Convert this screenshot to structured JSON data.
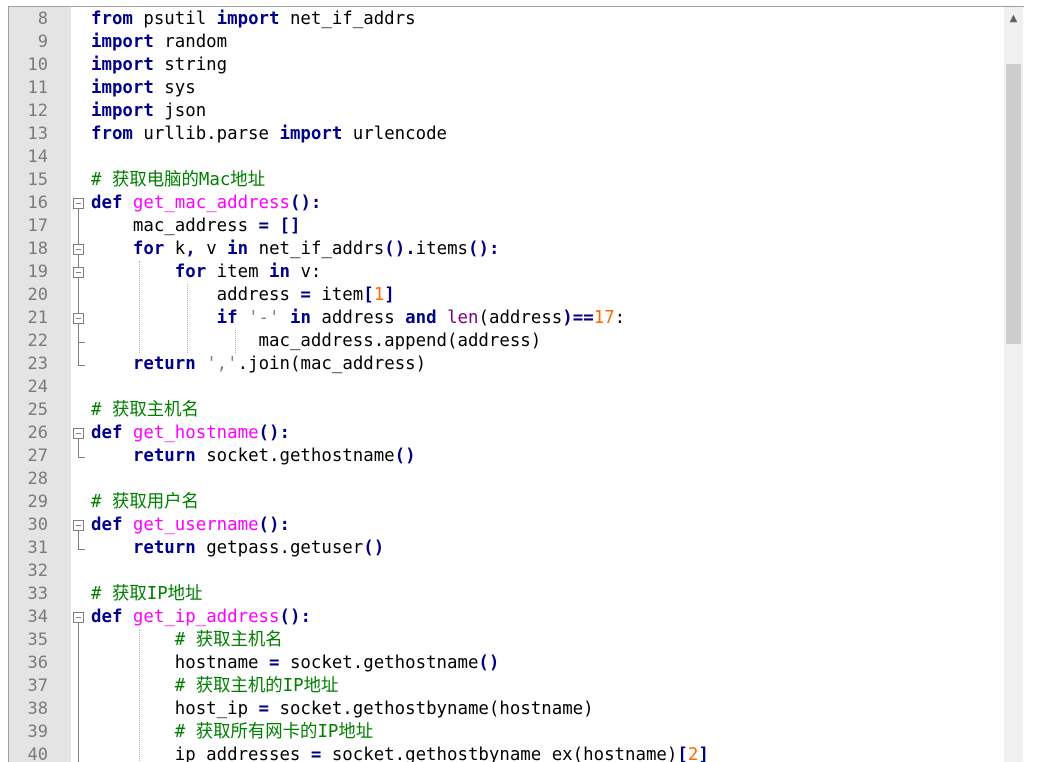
{
  "editor": {
    "lines": [
      {
        "num": "8",
        "parts": [
          {
            "t": "from",
            "c": "kw"
          },
          {
            "t": " psutil "
          },
          {
            "t": "import",
            "c": "kw"
          },
          {
            "t": " net_if_addrs"
          }
        ]
      },
      {
        "num": "9",
        "parts": [
          {
            "t": "import",
            "c": "kw"
          },
          {
            "t": " random"
          }
        ]
      },
      {
        "num": "10",
        "parts": [
          {
            "t": "import",
            "c": "kw"
          },
          {
            "t": " string"
          }
        ]
      },
      {
        "num": "11",
        "parts": [
          {
            "t": "import",
            "c": "kw"
          },
          {
            "t": " sys"
          }
        ]
      },
      {
        "num": "12",
        "parts": [
          {
            "t": "import",
            "c": "kw"
          },
          {
            "t": " json"
          }
        ]
      },
      {
        "num": "13",
        "parts": [
          {
            "t": "from",
            "c": "kw"
          },
          {
            "t": " urllib.parse "
          },
          {
            "t": "import",
            "c": "kw"
          },
          {
            "t": " urlencode"
          }
        ]
      },
      {
        "num": "14",
        "parts": []
      },
      {
        "num": "15",
        "parts": [
          {
            "t": "# 获取电脑的Mac地址",
            "c": "cm"
          }
        ]
      },
      {
        "num": "16",
        "parts": [
          {
            "t": "def",
            "c": "kw"
          },
          {
            "t": " "
          },
          {
            "t": "get_mac_address",
            "c": "fn"
          },
          {
            "t": "():",
            "c": "op"
          }
        ]
      },
      {
        "num": "17",
        "parts": [
          {
            "t": "    mac_address "
          },
          {
            "t": "=",
            "c": "op"
          },
          {
            "t": " "
          },
          {
            "t": "[]",
            "c": "op"
          }
        ]
      },
      {
        "num": "18",
        "parts": [
          {
            "t": "    "
          },
          {
            "t": "for",
            "c": "kw"
          },
          {
            "t": " k"
          },
          {
            "t": ",",
            "c": "op"
          },
          {
            "t": " v "
          },
          {
            "t": "in",
            "c": "kw"
          },
          {
            "t": " net_if_addrs"
          },
          {
            "t": "().",
            "c": "op"
          },
          {
            "t": "items"
          },
          {
            "t": "():",
            "c": "op"
          }
        ]
      },
      {
        "num": "19",
        "parts": [
          {
            "t": "        "
          },
          {
            "t": "for",
            "c": "kw"
          },
          {
            "t": " item "
          },
          {
            "t": "in",
            "c": "kw"
          },
          {
            "t": " v:"
          }
        ]
      },
      {
        "num": "20",
        "parts": [
          {
            "t": "            address "
          },
          {
            "t": "=",
            "c": "op"
          },
          {
            "t": " item"
          },
          {
            "t": "[",
            "c": "op"
          },
          {
            "t": "1",
            "c": "nm"
          },
          {
            "t": "]",
            "c": "op"
          }
        ]
      },
      {
        "num": "21",
        "parts": [
          {
            "t": "            "
          },
          {
            "t": "if",
            "c": "kw"
          },
          {
            "t": " "
          },
          {
            "t": "'-'",
            "c": "st"
          },
          {
            "t": " "
          },
          {
            "t": "in",
            "c": "kw"
          },
          {
            "t": " address "
          },
          {
            "t": "and",
            "c": "kw"
          },
          {
            "t": " "
          },
          {
            "t": "len",
            "c": "bi"
          },
          {
            "t": "("
          },
          {
            "t": "address"
          },
          {
            "t": ")==",
            "c": "op"
          },
          {
            "t": "17",
            "c": "nm"
          },
          {
            "t": ":"
          }
        ]
      },
      {
        "num": "22",
        "parts": [
          {
            "t": "                mac_address.append"
          },
          {
            "t": "("
          },
          {
            "t": "address"
          },
          {
            "t": ")"
          }
        ]
      },
      {
        "num": "23",
        "parts": [
          {
            "t": "    "
          },
          {
            "t": "return",
            "c": "kw"
          },
          {
            "t": " "
          },
          {
            "t": "','",
            "c": "st"
          },
          {
            "t": ".join"
          },
          {
            "t": "("
          },
          {
            "t": "mac_address"
          },
          {
            "t": ")"
          }
        ]
      },
      {
        "num": "24",
        "parts": []
      },
      {
        "num": "25",
        "parts": [
          {
            "t": "# 获取主机名",
            "c": "cm"
          }
        ]
      },
      {
        "num": "26",
        "parts": [
          {
            "t": "def",
            "c": "kw"
          },
          {
            "t": " "
          },
          {
            "t": "get_hostname",
            "c": "fn"
          },
          {
            "t": "():",
            "c": "op"
          }
        ]
      },
      {
        "num": "27",
        "parts": [
          {
            "t": "    "
          },
          {
            "t": "return",
            "c": "kw"
          },
          {
            "t": " socket.gethostname"
          },
          {
            "t": "()",
            "c": "op"
          }
        ]
      },
      {
        "num": "28",
        "parts": []
      },
      {
        "num": "29",
        "parts": [
          {
            "t": "# 获取用户名",
            "c": "cm"
          }
        ]
      },
      {
        "num": "30",
        "parts": [
          {
            "t": "def",
            "c": "kw"
          },
          {
            "t": " "
          },
          {
            "t": "get_username",
            "c": "fn"
          },
          {
            "t": "():",
            "c": "op"
          }
        ]
      },
      {
        "num": "31",
        "parts": [
          {
            "t": "    "
          },
          {
            "t": "return",
            "c": "kw"
          },
          {
            "t": " getpass.getuser"
          },
          {
            "t": "()",
            "c": "op"
          }
        ]
      },
      {
        "num": "32",
        "parts": []
      },
      {
        "num": "33",
        "parts": [
          {
            "t": "# 获取IP地址",
            "c": "cm"
          }
        ]
      },
      {
        "num": "34",
        "parts": [
          {
            "t": "def",
            "c": "kw"
          },
          {
            "t": " "
          },
          {
            "t": "get_ip_address",
            "c": "fn"
          },
          {
            "t": "():",
            "c": "op"
          }
        ]
      },
      {
        "num": "35",
        "parts": [
          {
            "t": "        "
          },
          {
            "t": "# 获取主机名",
            "c": "cm"
          }
        ]
      },
      {
        "num": "36",
        "parts": [
          {
            "t": "        hostname "
          },
          {
            "t": "=",
            "c": "op"
          },
          {
            "t": " socket.gethostname"
          },
          {
            "t": "()",
            "c": "op"
          }
        ]
      },
      {
        "num": "37",
        "parts": [
          {
            "t": "        "
          },
          {
            "t": "# 获取主机的IP地址",
            "c": "cm"
          }
        ]
      },
      {
        "num": "38",
        "parts": [
          {
            "t": "        host_ip "
          },
          {
            "t": "=",
            "c": "op"
          },
          {
            "t": " socket.gethostbyname"
          },
          {
            "t": "("
          },
          {
            "t": "hostname"
          },
          {
            "t": ")"
          }
        ]
      },
      {
        "num": "39",
        "parts": [
          {
            "t": "        "
          },
          {
            "t": "# 获取所有网卡的IP地址",
            "c": "cm"
          }
        ]
      },
      {
        "num": "40",
        "parts": [
          {
            "t": "        ip_addresses "
          },
          {
            "t": "=",
            "c": "op"
          },
          {
            "t": " socket.gethostbyname_ex"
          },
          {
            "t": "("
          },
          {
            "t": "hostname"
          },
          {
            "t": ")"
          },
          {
            "t": "[",
            "c": "op"
          },
          {
            "t": "2",
            "c": "nm"
          },
          {
            "t": "]",
            "c": "op"
          }
        ]
      }
    ]
  },
  "scrollbar": {
    "up_arrow": "▲"
  },
  "colors": {
    "keyword": "#00008b",
    "function": "#ff00ff",
    "comment": "#008000",
    "string": "#808080",
    "number": "#ff6a00",
    "gutter_bg": "#e4e4e4"
  }
}
